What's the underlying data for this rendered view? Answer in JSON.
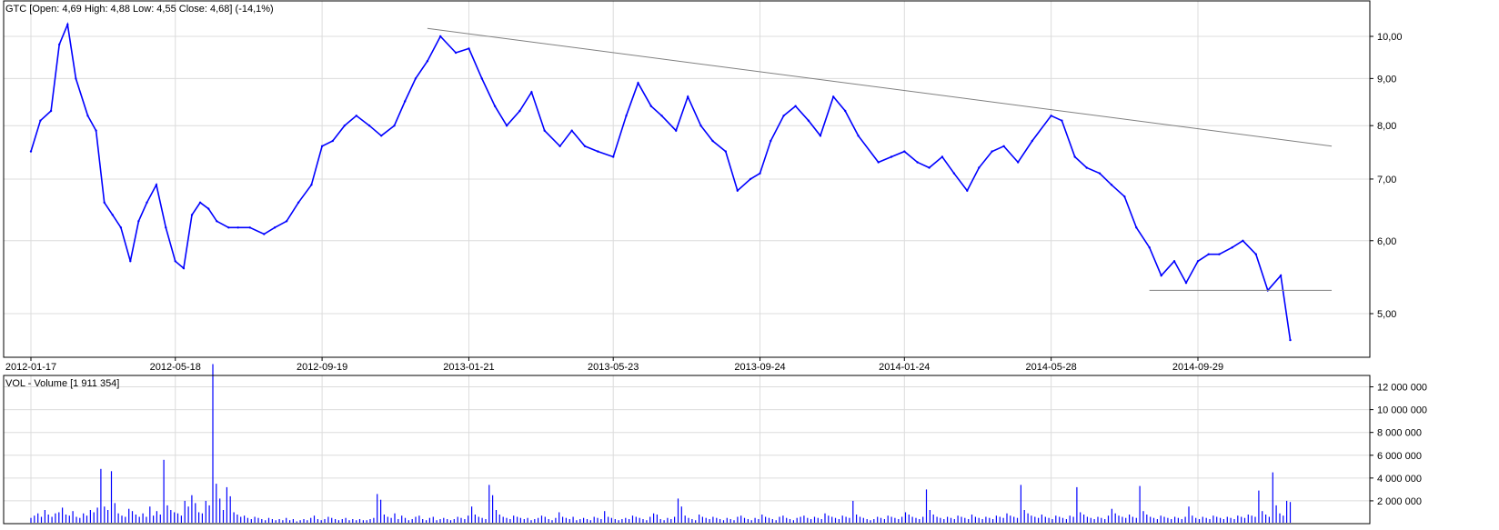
{
  "price_panel": {
    "header": "GTC [Open: 4,69  High: 4,88  Low: 4,55  Close: 4,68] (-14,1%)",
    "y_ticks": [
      "10,00",
      "9,00",
      "8,00",
      "7,00",
      "6,00",
      "5,00"
    ],
    "x_ticks": [
      "2012-01-17",
      "2012-05-18",
      "2012-09-19",
      "2013-01-21",
      "2013-05-23",
      "2013-09-24",
      "2014-01-24",
      "2014-05-28",
      "2014-09-29"
    ]
  },
  "volume_panel": {
    "header": "VOL - Volume [1 911 354]",
    "y_ticks": [
      "12 000 000",
      "10 000 000",
      "8 000 000",
      "6 000 000",
      "4 000 000",
      "2 000 000"
    ]
  },
  "colors": {
    "series": "#0000ff",
    "grid": "#dcdcdc",
    "trendline": "#808080",
    "frame": "#000000"
  },
  "chart_data": [
    {
      "type": "line",
      "scale": "log",
      "grid": true,
      "ylim": [
        4.4,
        10.7
      ],
      "series": [
        {
          "x": [
            "2012-01-17",
            "2012-01-25",
            "2012-02-03",
            "2012-02-10",
            "2012-02-17",
            "2012-02-24",
            "2012-03-05",
            "2012-03-12",
            "2012-03-19",
            "2012-03-26",
            "2012-04-02",
            "2012-04-10",
            "2012-04-17",
            "2012-04-24",
            "2012-05-02",
            "2012-05-10",
            "2012-05-18",
            "2012-05-25",
            "2012-06-01",
            "2012-06-08",
            "2012-06-15",
            "2012-06-22",
            "2012-07-02",
            "2012-07-10",
            "2012-07-20",
            "2012-08-01",
            "2012-08-10",
            "2012-08-20",
            "2012-08-30",
            "2012-09-10",
            "2012-09-19",
            "2012-09-28",
            "2012-10-08",
            "2012-10-18",
            "2012-10-29",
            "2012-11-08",
            "2012-11-19",
            "2012-11-28",
            "2012-12-07",
            "2012-12-17",
            "2012-12-28",
            "2013-01-10",
            "2013-01-21",
            "2013-02-01",
            "2013-02-12",
            "2013-02-22",
            "2013-03-05",
            "2013-03-15",
            "2013-03-26",
            "2013-04-08",
            "2013-04-18",
            "2013-04-29",
            "2013-05-10",
            "2013-05-23",
            "2013-06-03",
            "2013-06-13",
            "2013-06-24",
            "2013-07-03",
            "2013-07-15",
            "2013-07-25",
            "2013-08-05",
            "2013-08-15",
            "2013-08-26",
            "2013-09-05",
            "2013-09-16",
            "2013-09-24",
            "2013-10-03",
            "2013-10-14",
            "2013-10-24",
            "2013-11-04",
            "2013-11-14",
            "2013-11-25",
            "2013-12-05",
            "2013-12-16",
            "2014-01-02",
            "2014-01-13",
            "2014-01-24",
            "2014-02-04",
            "2014-02-14",
            "2014-02-25",
            "2014-03-07",
            "2014-03-18",
            "2014-03-28",
            "2014-04-08",
            "2014-04-18",
            "2014-04-30",
            "2014-05-12",
            "2014-05-28",
            "2014-06-06",
            "2014-06-17",
            "2014-06-27",
            "2014-07-08",
            "2014-07-18",
            "2014-07-29",
            "2014-08-08",
            "2014-08-19",
            "2014-08-29",
            "2014-09-09",
            "2014-09-19",
            "2014-09-29",
            "2014-10-08",
            "2014-10-17",
            "2014-10-28",
            "2014-11-06",
            "2014-11-17",
            "2014-11-27",
            "2014-12-08",
            "2014-12-16"
          ],
          "y": [
            7.5,
            8.1,
            8.3,
            9.8,
            10.3,
            9.0,
            8.2,
            7.9,
            6.6,
            6.4,
            6.2,
            5.7,
            6.3,
            6.6,
            6.9,
            6.2,
            5.7,
            5.6,
            6.4,
            6.6,
            6.5,
            6.3,
            6.2,
            6.2,
            6.2,
            6.1,
            6.2,
            6.3,
            6.6,
            6.9,
            7.6,
            7.7,
            8.0,
            8.2,
            8.0,
            7.8,
            8.0,
            8.5,
            9.0,
            9.4,
            10.0,
            9.6,
            9.7,
            9.0,
            8.4,
            8.0,
            8.3,
            8.7,
            7.9,
            7.6,
            7.9,
            7.6,
            7.5,
            7.4,
            8.2,
            8.9,
            8.4,
            8.2,
            7.9,
            8.6,
            8.0,
            7.7,
            7.5,
            6.8,
            7.0,
            7.1,
            7.7,
            8.2,
            8.4,
            8.1,
            7.8,
            8.6,
            8.3,
            7.8,
            7.3,
            7.4,
            7.5,
            7.3,
            7.2,
            7.4,
            7.1,
            6.8,
            7.2,
            7.5,
            7.6,
            7.3,
            7.7,
            8.2,
            8.1,
            7.4,
            7.2,
            7.1,
            6.9,
            6.7,
            6.2,
            5.9,
            5.5,
            5.7,
            5.4,
            5.7,
            5.8,
            5.8,
            5.9,
            6.0,
            5.8,
            5.3,
            5.5,
            4.68
          ]
        }
      ],
      "annotations": [
        {
          "type": "trendline",
          "from": {
            "x": "2012-12-17",
            "y": 10.2
          },
          "to": {
            "x": "2015-01-20",
            "y": 7.6
          }
        },
        {
          "type": "support",
          "from": {
            "x": "2014-08-19",
            "y": 5.3
          },
          "to": {
            "x": "2015-01-20",
            "y": 5.3
          }
        }
      ]
    },
    {
      "type": "bar",
      "grid": true,
      "ylim": [
        0,
        13000000
      ],
      "x_range": [
        "2012-01-17",
        "2014-12-16"
      ],
      "values": [
        500000,
        700000,
        900000,
        600000,
        1200000,
        800000,
        600000,
        900000,
        1000000,
        1400000,
        800000,
        700000,
        1100000,
        600000,
        500000,
        900000,
        700000,
        1200000,
        1000000,
        1400000,
        4800000,
        1500000,
        1200000,
        4600000,
        1800000,
        900000,
        700000,
        600000,
        1300000,
        1100000,
        800000,
        600000,
        900000,
        600000,
        1500000,
        700000,
        1100000,
        800000,
        5600000,
        1600000,
        1200000,
        1000000,
        900000,
        700000,
        2000000,
        1500000,
        2500000,
        1800000,
        1000000,
        900000,
        2000000,
        1600000,
        14000000,
        3500000,
        2200000,
        1200000,
        3200000,
        2400000,
        1000000,
        800000,
        600000,
        700000,
        500000,
        400000,
        600000,
        500000,
        400000,
        300000,
        500000,
        400000,
        300000,
        400000,
        300000,
        500000,
        300000,
        400000,
        200000,
        300000,
        400000,
        300000,
        500000,
        700000,
        400000,
        300000,
        400000,
        600000,
        500000,
        400000,
        300000,
        400000,
        500000,
        300000,
        400000,
        300000,
        400000,
        300000,
        300000,
        400000,
        500000,
        2600000,
        2100000,
        800000,
        600000,
        500000,
        900000,
        400000,
        700000,
        500000,
        300000,
        400000,
        600000,
        700000,
        400000,
        300000,
        500000,
        600000,
        300000,
        400000,
        500000,
        400000,
        300000,
        400000,
        600000,
        500000,
        400000,
        700000,
        1500000,
        800000,
        600000,
        500000,
        400000,
        3400000,
        2500000,
        1200000,
        800000,
        600000,
        500000,
        400000,
        700000,
        600000,
        500000,
        400000,
        500000,
        300000,
        400000,
        500000,
        700000,
        600000,
        400000,
        300000,
        500000,
        1000000,
        600000,
        500000,
        400000,
        600000,
        300000,
        400000,
        500000,
        400000,
        300000,
        600000,
        500000,
        400000,
        1100000,
        600000,
        500000,
        400000,
        300000,
        400000,
        500000,
        400000,
        700000,
        600000,
        500000,
        400000,
        300000,
        600000,
        900000,
        800000,
        400000,
        300000,
        500000,
        400000,
        600000,
        2200000,
        1500000,
        700000,
        500000,
        400000,
        300000,
        800000,
        600000,
        500000,
        400000,
        600000,
        500000,
        400000,
        300000,
        500000,
        400000,
        300000,
        600000,
        700000,
        500000,
        400000,
        300000,
        500000,
        400000,
        800000,
        600000,
        500000,
        400000,
        300000,
        600000,
        700000,
        500000,
        400000,
        300000,
        500000,
        600000,
        700000,
        500000,
        400000,
        600000,
        500000,
        400000,
        900000,
        700000,
        600000,
        500000,
        400000,
        700000,
        600000,
        500000,
        2000000,
        800000,
        600000,
        500000,
        400000,
        300000,
        400000,
        600000,
        500000,
        400000,
        700000,
        600000,
        500000,
        400000,
        600000,
        1000000,
        800000,
        600000,
        500000,
        400000,
        600000,
        3000000,
        1200000,
        800000,
        600000,
        500000,
        400000,
        600000,
        500000,
        400000,
        700000,
        600000,
        500000,
        400000,
        800000,
        600000,
        500000,
        400000,
        600000,
        500000,
        400000,
        700000,
        600000,
        500000,
        900000,
        700000,
        600000,
        500000,
        3400000,
        1200000,
        900000,
        700000,
        600000,
        500000,
        800000,
        600000,
        500000,
        400000,
        700000,
        600000,
        500000,
        400000,
        700000,
        600000,
        3200000,
        1000000,
        800000,
        600000,
        500000,
        400000,
        600000,
        500000,
        400000,
        700000,
        1300000,
        900000,
        700000,
        600000,
        500000,
        800000,
        600000,
        500000,
        3300000,
        1100000,
        800000,
        600000,
        500000,
        400000,
        700000,
        600000,
        500000,
        400000,
        600000,
        500000,
        400000,
        600000,
        1500000,
        700000,
        500000,
        400000,
        600000,
        500000,
        400000,
        700000,
        600000,
        500000,
        400000,
        600000,
        500000,
        400000,
        700000,
        600000,
        500000,
        800000,
        700000,
        600000,
        2900000,
        1100000,
        800000,
        600000,
        4500000,
        1600000,
        900000,
        700000,
        2000000,
        1900000
      ]
    }
  ]
}
